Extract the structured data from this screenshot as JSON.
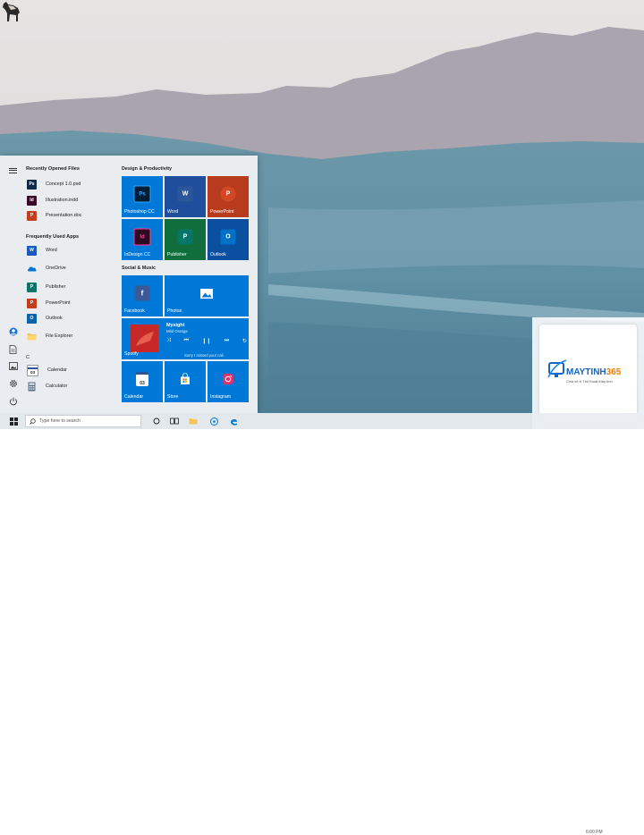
{
  "recent_files": {
    "header": "Recently Opened Files",
    "items": [
      {
        "label": "Concept 1.0.psd",
        "icon": "photoshop-file-icon",
        "color": "#0f2a47"
      },
      {
        "label": "Illustration.indd",
        "icon": "indesign-file-icon",
        "color": "#3b0c2a"
      },
      {
        "label": "Presentation.doc",
        "icon": "document-file-icon",
        "color": "#c43e1c"
      }
    ]
  },
  "frequent_apps": {
    "header": "Frequently Used Apps",
    "items": [
      {
        "label": "Word",
        "icon": "word-icon",
        "color": "#185abd"
      },
      {
        "label": "OneDrive",
        "icon": "onedrive-icon",
        "color": "#0078d4"
      },
      {
        "label": "Publisher",
        "icon": "publisher-icon",
        "color": "#077568"
      },
      {
        "label": "PowerPoint",
        "icon": "powerpoint-icon",
        "color": "#c43e1c"
      },
      {
        "label": "Outlook",
        "icon": "outlook-icon",
        "color": "#0a64ad"
      },
      {
        "label": "File Explorer",
        "icon": "folder-icon",
        "color": "#f2c45a"
      }
    ]
  },
  "alpha_section": {
    "letter": "C",
    "items": [
      {
        "label": "Calendar",
        "icon": "calendar-icon",
        "day": "03"
      },
      {
        "label": "Calculator",
        "icon": "calculator-icon"
      }
    ]
  },
  "design_group": {
    "header": "Design & Productivity",
    "tiles": [
      {
        "label": "Photoshop CC",
        "glyph": "Ps",
        "bg": "#0078d7",
        "icon_bg": "#001d34"
      },
      {
        "label": "Word",
        "glyph": "W",
        "bg": "#1f4e9c",
        "icon_bg": "#2b579a"
      },
      {
        "label": "PowerPoint",
        "glyph": "P",
        "bg": "#b83b1e",
        "icon_bg": "#d24726"
      },
      {
        "label": "InDesign CC",
        "glyph": "Id",
        "bg": "#0078d7",
        "icon_bg": "#2d0a1f"
      },
      {
        "label": "Publisher",
        "glyph": "P",
        "bg": "#0f6e3b",
        "icon_bg": "#077568"
      },
      {
        "label": "Outlook",
        "glyph": "O",
        "bg": "#0a4fa0",
        "icon_bg": "#0072c6"
      }
    ]
  },
  "social_group": {
    "header": "Social & Music",
    "facebook": {
      "label": "Facebook",
      "glyph": "f"
    },
    "photos": {
      "label": "Photos"
    },
    "spotify": {
      "label": "Spotify",
      "track_title": "Mysight",
      "track_artist": "Mild Orange",
      "message": "Sorry I missed your call",
      "controls": [
        "shuffle",
        "previous",
        "pause",
        "next",
        "repeat"
      ]
    },
    "calendar": {
      "label": "Calendar",
      "day": "03"
    },
    "store": {
      "label": "Store"
    },
    "instagram": {
      "label": "Instagram"
    }
  },
  "taskbar": {
    "search_placeholder": "Type here to search",
    "clock_text": "6:00 PM"
  },
  "watermark": {
    "brand_main": "MAYTINH",
    "brand_number": "365",
    "subtitle": "Chia sẻ & Thủ thuật Máy tính"
  },
  "colors": {
    "tile_blue": "#0078d7",
    "accent": "#0078d7"
  }
}
